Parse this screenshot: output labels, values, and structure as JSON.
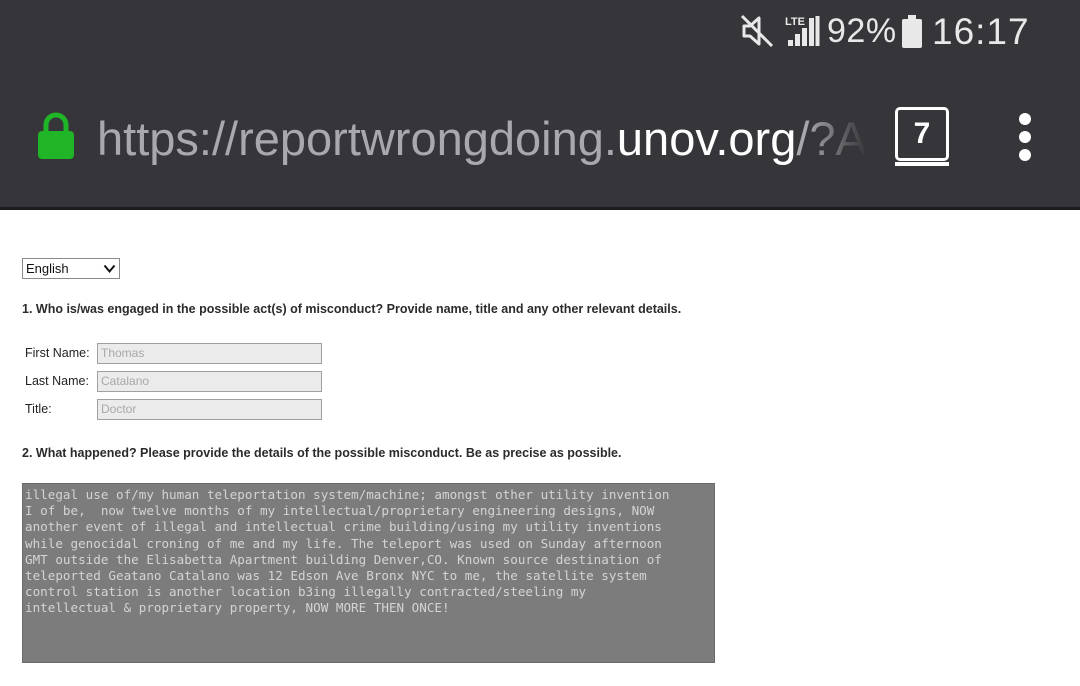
{
  "status_bar": {
    "icons": [
      "mute-icon",
      "lte-signal-icon",
      "battery-icon"
    ],
    "network_label": "LTE",
    "battery_percent": "92%",
    "battery_level": 0.92,
    "time": "16:17"
  },
  "browser": {
    "url_prefix": "https://reportwrongdoing.",
    "url_domain": "unov.org",
    "url_suffix": "/?A",
    "tab_count": "7",
    "icons": [
      "lock-icon",
      "tabs-icon",
      "overflow-menu-icon"
    ],
    "colors": {
      "chrome_bg": "#36363a",
      "lock": "#1fb527"
    }
  },
  "form": {
    "language_select": {
      "selected": "English"
    },
    "question1": "1. Who is/was engaged in the possible act(s) of misconduct?  Provide name, title and any other relevant details.",
    "fields": [
      {
        "label": "First Name:",
        "value": "Thomas"
      },
      {
        "label": "Last Name:",
        "value": "Catalano"
      },
      {
        "label": "Title:",
        "value": "Doctor"
      }
    ],
    "question2": "2. What happened?  Please provide the details of the possible misconduct.  Be as precise as possible.",
    "details": "illegal use of/my human teleportation system/machine; amongst other utility invention\nI of be,  now twelve months of my intellectual/proprietary engineering designs, NOW\nanother event of illegal and intellectual crime building/using my utility inventions\nwhile genocidal croning of me and my life. The teleport was used on Sunday afternoon\nGMT outside the Elisabetta Apartment building Denver,CO. Known source destination of\nteleported Geatano Catalano was 12 Edson Ave Bronx NYC to me, the satellite system\ncontrol station is another location b3ing illegally contracted/steeling my\nintellectual & proprietary property, NOW MORE THEN ONCE!"
  }
}
